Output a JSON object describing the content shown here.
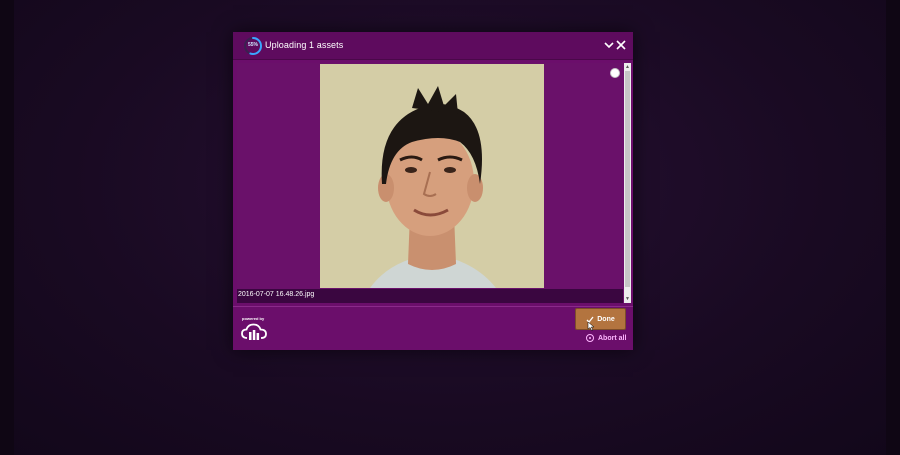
{
  "dialog": {
    "title": "Uploading 1 assets",
    "progress_label": "55%",
    "progress_value": 0.55
  },
  "file": {
    "name": "2016-07-07 16.48.26.jpg"
  },
  "footer": {
    "powered_by": "powered by",
    "done_label": "Done",
    "abort_label": "Abort all"
  },
  "colors": {
    "dialog_bg": "#6b0e6b",
    "header_bg": "#5e0b5e",
    "accent_ring": "#3da5ff",
    "done_button": "#b3743f",
    "abort_link": "#ffb6ff"
  },
  "icons": [
    "progress-ring-icon",
    "chevron-down-icon",
    "close-icon",
    "status-dot-icon",
    "cloud-logo-icon",
    "checkmark-icon",
    "abort-icon",
    "cursor-icon"
  ]
}
